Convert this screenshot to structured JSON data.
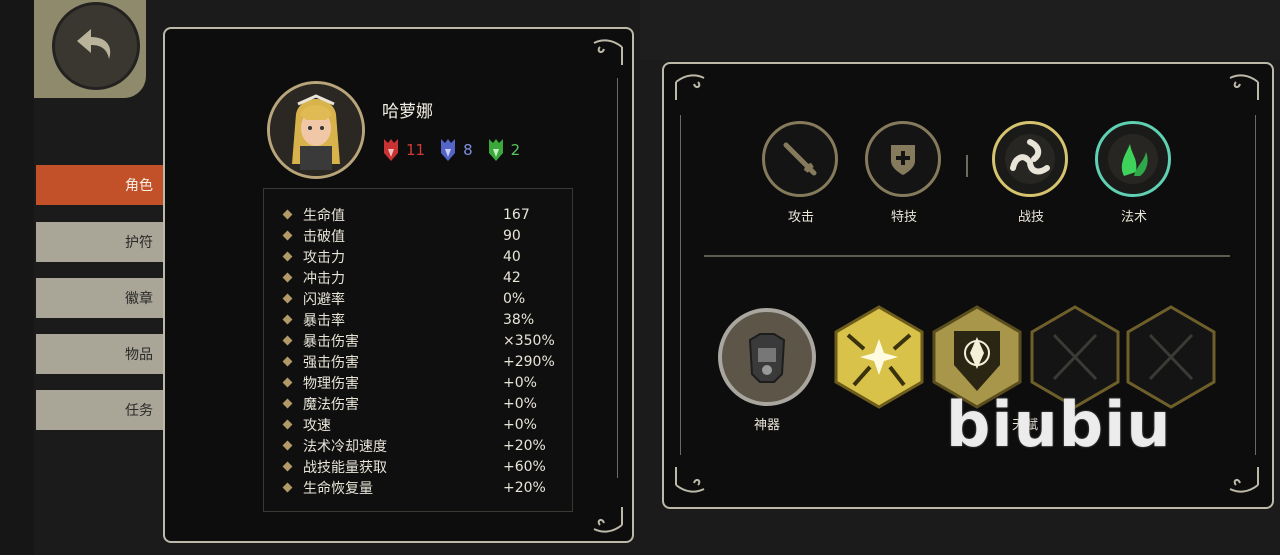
{
  "side_tabs": [
    {
      "label": "角色",
      "active": true
    },
    {
      "label": "护符",
      "active": false
    },
    {
      "label": "徽章",
      "active": false
    },
    {
      "label": "物品",
      "active": false
    },
    {
      "label": "任务",
      "active": false
    }
  ],
  "character": {
    "name": "哈萝娜",
    "badges": [
      {
        "icon": "red-shield-icon",
        "value": "11",
        "color": "#d23a3a"
      },
      {
        "icon": "blue-shield-icon",
        "value": "8",
        "color": "#7f8de0"
      },
      {
        "icon": "green-shield-icon",
        "value": "2",
        "color": "#5cc45c"
      }
    ]
  },
  "stats": [
    {
      "label": "生命值",
      "value": "167"
    },
    {
      "label": "击破值",
      "value": "90"
    },
    {
      "label": "攻击力",
      "value": "40"
    },
    {
      "label": "冲击力",
      "value": "42"
    },
    {
      "label": "闪避率",
      "value": "0%"
    },
    {
      "label": "暴击率",
      "value": "38%"
    },
    {
      "label": "暴击伤害",
      "value": "×350%"
    },
    {
      "label": "强击伤害",
      "value": "+290%"
    },
    {
      "label": "物理伤害",
      "value": "+0%"
    },
    {
      "label": "魔法伤害",
      "value": "+0%"
    },
    {
      "label": "攻速",
      "value": "+0%"
    },
    {
      "label": "法术冷却速度",
      "value": "+20%"
    },
    {
      "label": "战技能量获取",
      "value": "+60%"
    },
    {
      "label": "生命恢复量",
      "value": "+20%"
    }
  ],
  "skills": [
    {
      "label": "攻击",
      "icon": "sword-icon"
    },
    {
      "label": "特技",
      "icon": "shield-plus-icon"
    },
    {
      "label": "战技",
      "icon": "triskelion-icon"
    },
    {
      "label": "法术",
      "icon": "green-flame-icon"
    }
  ],
  "artifact_label": "神器",
  "talent_label": "天赋",
  "watermark": "biubiu"
}
